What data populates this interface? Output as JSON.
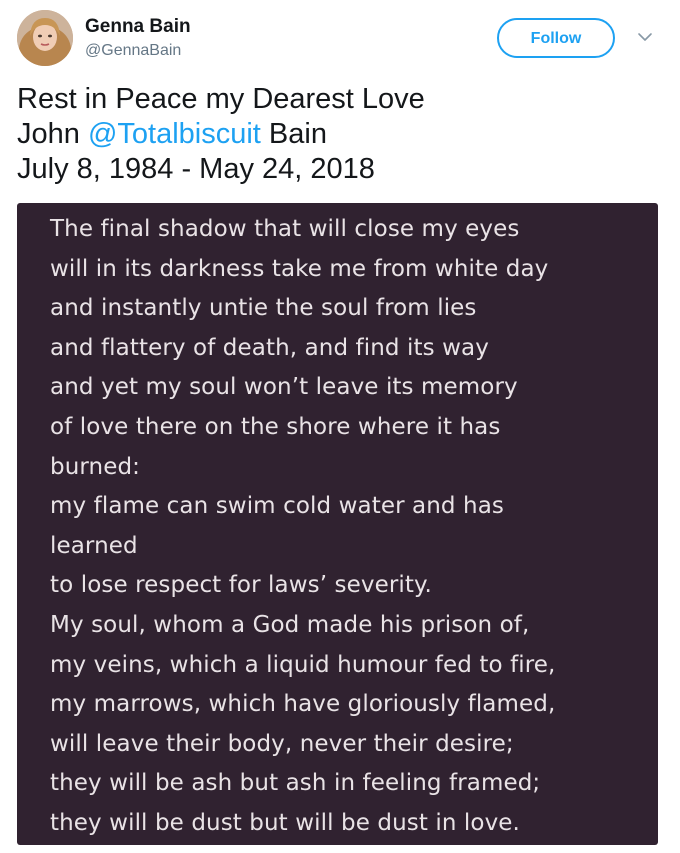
{
  "user": {
    "display_name": "Genna Bain",
    "handle": "@GennaBain",
    "avatar_icon": "profile-photo"
  },
  "follow_button": {
    "label": "Follow"
  },
  "menu": {
    "icon": "chevron-down-icon"
  },
  "tweet": {
    "line1": "Rest in Peace my Dearest Love",
    "line2_prefix": "John ",
    "mention": "@Totalbiscuit",
    "line2_suffix": " Bain",
    "line3": "July 8, 1984 - May 24, 2018"
  },
  "poem": {
    "lines": [
      "The final shadow that will close my eyes",
      "will in its darkness take me from white day",
      "and instantly untie the soul from lies",
      "and flattery of death, and find its way",
      "and yet my soul won’t leave its memory",
      "of love there on the shore where it has",
      "burned:",
      "my flame can swim cold water and has",
      "learned",
      "to lose respect for laws’ severity.",
      "My soul, whom a God made his prison of,",
      "my veins, which a liquid humour fed to fire,",
      "my marrows, which have gloriously flamed,",
      "will leave their body, never their desire;",
      "they will be ash but ash in feeling framed;",
      "they will be dust but will be dust in love."
    ]
  },
  "colors": {
    "accent": "#1da1f2",
    "card_background": "#302230",
    "card_text": "#e9e3e6",
    "primary_text": "#14171a",
    "secondary_text": "#657786"
  }
}
